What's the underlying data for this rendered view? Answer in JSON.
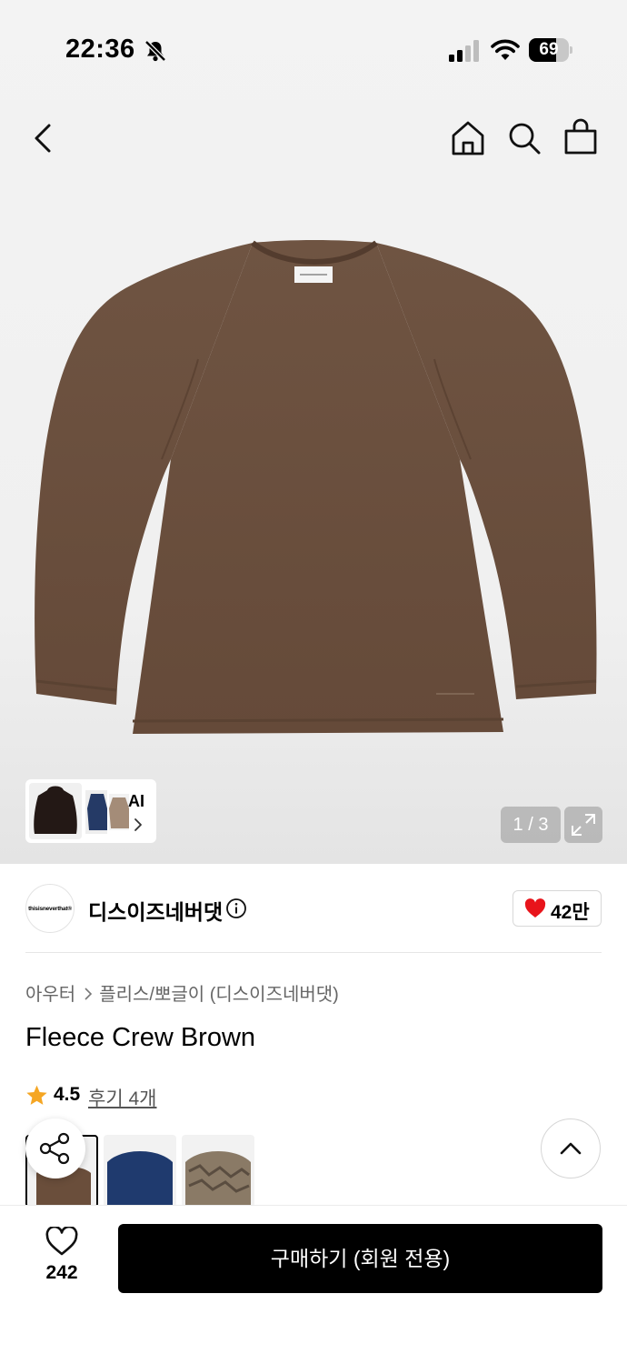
{
  "status_bar": {
    "time": "22:36",
    "battery": "69",
    "battery_level": 0.69,
    "icons": [
      "bell-slash-icon",
      "cellular-signal-icon",
      "wifi-icon",
      "battery-icon"
    ]
  },
  "nav": {
    "icons": [
      "chevron-left-icon",
      "home-icon",
      "search-icon",
      "shopping-bag-icon"
    ]
  },
  "gallery": {
    "ai_label": "AI",
    "pager": "1 / 3",
    "product_color": "#6b513f"
  },
  "brand": {
    "logo_text": "thisisneverthat®",
    "name": "디스이즈네버댓",
    "likes": "42만"
  },
  "product": {
    "breadcrumb": [
      "아우터",
      "플리스/뽀글이 (디스이즈네버댓)"
    ],
    "title": "Fleece Crew Brown",
    "rating": "4.5",
    "reviews": "후기 4개",
    "swatch_colors": [
      "#6a4e3b",
      "#1f3a6e",
      "#8a7a66"
    ]
  },
  "bottom_bar": {
    "wish_count": "242",
    "buy_label": "구매하기 (회원 전용)"
  },
  "colors": {
    "accent_heart": "#e8141b",
    "star": "#f5a623",
    "primary_button": "#000000"
  }
}
